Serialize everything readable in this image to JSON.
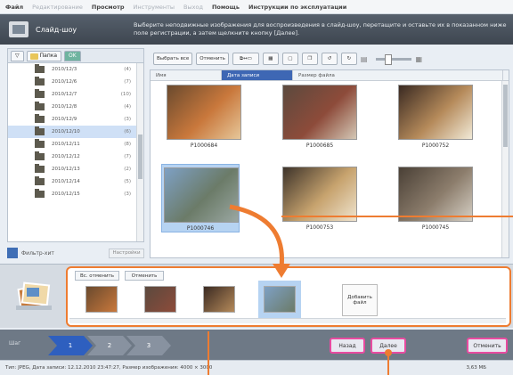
{
  "menubar": {
    "items": [
      {
        "label": "Файл",
        "dim": false
      },
      {
        "label": "Редактирование",
        "dim": true
      },
      {
        "label": "Просмотр",
        "dim": false
      },
      {
        "label": "Инструменты",
        "dim": true
      },
      {
        "label": "Выход",
        "dim": true
      },
      {
        "label": "Помощь",
        "dim": false
      },
      {
        "label": "Инструкции по эксплуатации",
        "dim": false
      }
    ]
  },
  "header": {
    "title": "Слайд-шоу",
    "instructions": "Выберите неподвижные изображения для воспроизведения в слайд-шоу, перетащите и оставьте их в показанном ниже поле регистрации, а затем щелкните кнопку [Далее]."
  },
  "left_panel": {
    "tab_folder_label": "Папка",
    "tab_ok_label": "OK",
    "folders": [
      {
        "name": "2010/12/3",
        "count": "(4)"
      },
      {
        "name": "2010/12/6",
        "count": "(7)"
      },
      {
        "name": "2010/12/7",
        "count": "(10)"
      },
      {
        "name": "2010/12/8",
        "count": "(4)"
      },
      {
        "name": "2010/12/9",
        "count": "(3)"
      },
      {
        "name": "2010/12/10",
        "count": "(6)",
        "selected": true
      },
      {
        "name": "2010/12/11",
        "count": "(8)"
      },
      {
        "name": "2010/12/12",
        "count": "(7)"
      },
      {
        "name": "2010/12/13",
        "count": "(2)"
      },
      {
        "name": "2010/12/14",
        "count": "(5)"
      },
      {
        "name": "2010/12/15",
        "count": "(3)"
      }
    ],
    "filter_label": "Фильтр-хит",
    "filter_button": "Настройки"
  },
  "toolbar": {
    "select_all": "Выбрать все",
    "deselect": "Отменить"
  },
  "grid": {
    "columns": [
      "Имя",
      "Дата записи",
      "Размер файла"
    ],
    "thumbnails": [
      {
        "caption": "P1000684",
        "palette": [
          "#6a4a2e",
          "#c9783c",
          "#e6c79a"
        ],
        "selected": false
      },
      {
        "caption": "P1000685",
        "palette": [
          "#5b4a3e",
          "#8d4b3a",
          "#d4c8b6"
        ],
        "selected": false
      },
      {
        "caption": "P1000752",
        "palette": [
          "#3a2a22",
          "#b58a5a",
          "#f1ead8"
        ],
        "selected": false
      },
      {
        "caption": "P1000746",
        "palette": [
          "#7ea0c4",
          "#6b7b68",
          "#9aa7a2"
        ],
        "selected": true
      },
      {
        "caption": "P1000753",
        "palette": [
          "#3d332a",
          "#c7a36e",
          "#efe4cf"
        ],
        "selected": false
      },
      {
        "caption": "P1000745",
        "palette": [
          "#4a4036",
          "#8c7d6c",
          "#d6d0c5"
        ],
        "selected": false
      }
    ]
  },
  "strip": {
    "deselect_all": "Вс. отменить",
    "deselect": "Отменить",
    "add_file": "Добавить файл",
    "thumbs": [
      {
        "palette": [
          "#6a4a2e",
          "#c9783c"
        ]
      },
      {
        "palette": [
          "#5b4a3e",
          "#8d4b3a"
        ]
      },
      {
        "palette": [
          "#3a2a22",
          "#b58a5a"
        ]
      },
      {
        "palette": [
          "#7ea0c4",
          "#6b7b68"
        ],
        "selected": true
      }
    ]
  },
  "stepbar": {
    "label": "Шаг",
    "steps": [
      "1",
      "2",
      "3"
    ],
    "back": "Назад",
    "next": "Далее",
    "cancel": "Отменить"
  },
  "statusbar": {
    "info": "Тип: JPEG, Дата записи: 12.12.2010 23:47:27, Размер изображения: 4000 × 3000",
    "size": "3,63 МБ"
  },
  "colors": {
    "accent_orange": "#ee7c31",
    "highlight_pink": "#e84ba0",
    "selection_blue": "#b6d3f2",
    "step_blue": "#2e5fbf"
  }
}
